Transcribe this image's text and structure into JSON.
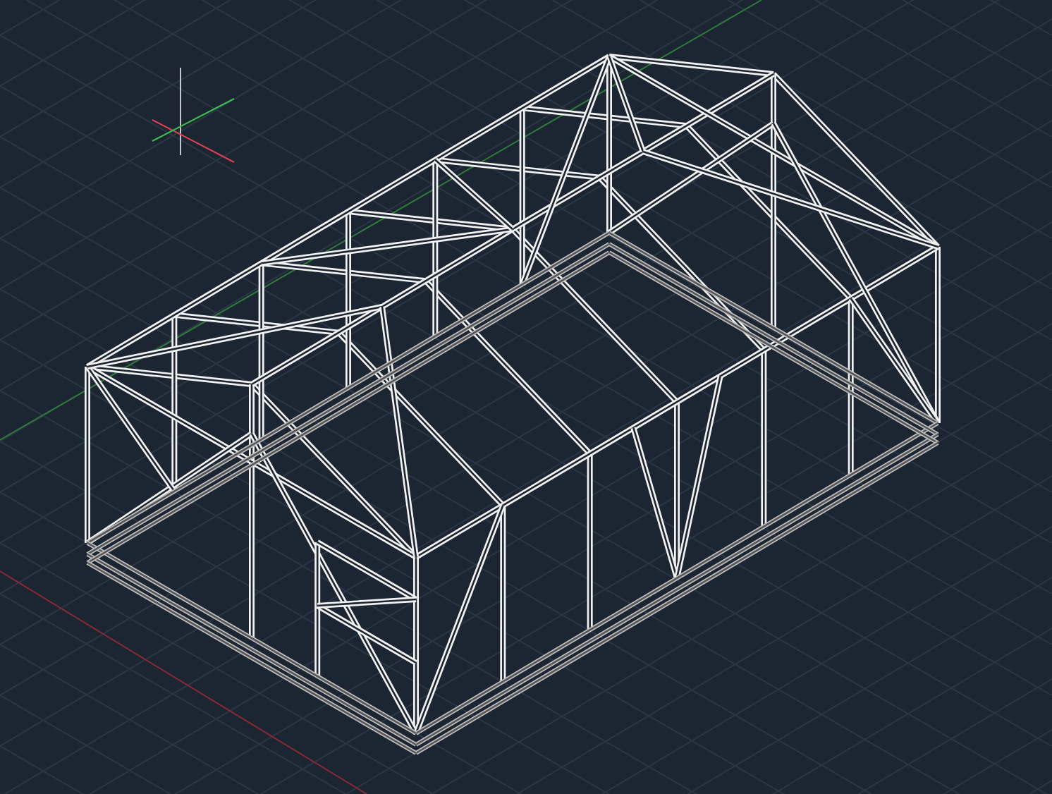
{
  "viewport": {
    "model_visible": true,
    "grid": true,
    "ucs_icon": true
  }
}
